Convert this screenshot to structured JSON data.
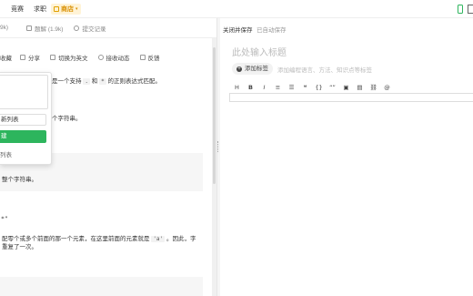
{
  "topnav": {
    "items": [
      "竞赛",
      "求职"
    ],
    "store": "商店",
    "store_arrow": "▾"
  },
  "subbar": {
    "items": [
      "9k)",
      "题解 (1.9k)",
      "提交记录"
    ]
  },
  "toolbar": {
    "items": [
      "收藏",
      "分享",
      "切换为英文",
      "接收动态",
      "反馈"
    ]
  },
  "content": {
    "p1_prefix": "是一个支持",
    "p1_code1": ".",
    "p1_and": "和",
    "p1_code2": "*",
    "p1_suffix": "的正则表达式匹配。",
    "p2": "个字符串。",
    "p3": "整个字符串。",
    "regex": "*\"",
    "p4_line1_prefix": "配零个或多个前面的那一个元素，在这里前面的元素就是",
    "p4_code": "'a'",
    "p4_line1_suffix": "。因此，字",
    "p4_line2": "重复了一次。"
  },
  "popup": {
    "input_value": "新列表",
    "button_label": "建",
    "list_label": "列表"
  },
  "editor": {
    "tab_active": "关闭并保存",
    "tab_status": "已自动保存",
    "title_placeholder": "此处输入标题",
    "add_tag": "添加标签",
    "tag_hint": "添加编程语言、方法、知识点等标签",
    "toolbar": [
      "H",
      "B",
      "I",
      "≡",
      "☰",
      "❝",
      "{}",
      "“”",
      "▣",
      "▤",
      "⛓",
      "@"
    ]
  },
  "colors": {
    "accent_green": "#2db55d",
    "store_orange": "#d98f00"
  }
}
